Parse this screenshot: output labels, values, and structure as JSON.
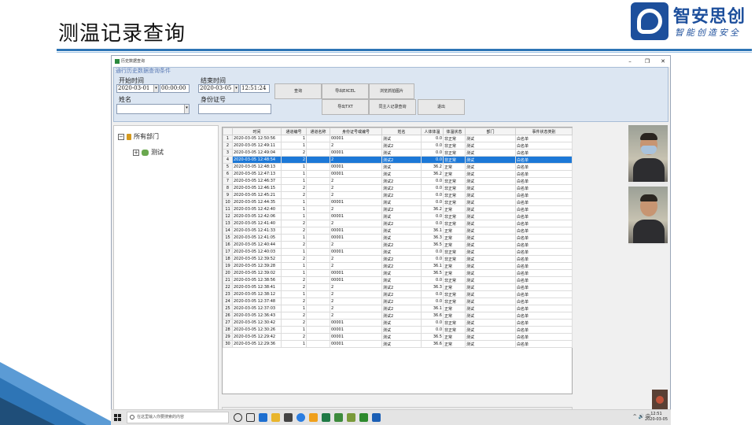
{
  "slide": {
    "title": "测温记录查询",
    "logo_name": "智安思创",
    "logo_slogan": "智能创造安全"
  },
  "window": {
    "title": "历史数据查询",
    "buttons": {
      "minimize": "–",
      "maximize": "❐",
      "close": "✕"
    }
  },
  "query": {
    "panel_title": "通行历史数据查询条件",
    "start_label": "开始时间",
    "start_date": "2020-03-01",
    "start_time": "00:00:00",
    "end_label": "结束时间",
    "end_date": "2020-03-05",
    "end_time": "12:51:24",
    "name_label": "姓名",
    "name_value": "",
    "id_label": "身份证号",
    "id_value": "",
    "buttons": {
      "search": "查询",
      "export_excel": "导出EXCEL",
      "export_txt": "导出TXT",
      "browse_photo": "浏览抓拍图片",
      "same_person": "同主人记录查询",
      "exit": "退出"
    }
  },
  "tree": {
    "root": "所有部门",
    "child": "测试"
  },
  "grid": {
    "columns": [
      "",
      "时间",
      "通道编号",
      "通道名称",
      "身份证号或编号",
      "姓名",
      "人体体温",
      "体温状态",
      "部门",
      "事件状态类别"
    ],
    "selected_row": 4,
    "rows": [
      [
        "1",
        "2020-03-05 12:50:56",
        "1",
        "",
        "00001",
        "测试",
        "0.0",
        "非正常",
        "测试",
        "白名单"
      ],
      [
        "2",
        "2020-03-05 12:49:11",
        "1",
        "",
        "2",
        "测试2",
        "0.0",
        "非正常",
        "测试",
        "白名单"
      ],
      [
        "3",
        "2020-03-05 12:49:04",
        "2",
        "",
        "00001",
        "测试",
        "0.0",
        "非正常",
        "测试",
        "白名单"
      ],
      [
        "4",
        "2020-03-05 12:48:54",
        "2",
        "",
        "2",
        "测试2",
        "0.0",
        "非正常",
        "测试",
        "白名单"
      ],
      [
        "5",
        "2020-03-05 12:48:13",
        "1",
        "",
        "00001",
        "测试",
        "36.2",
        "正常",
        "测试",
        "白名单"
      ],
      [
        "6",
        "2020-03-05 12:47:13",
        "1",
        "",
        "00001",
        "测试",
        "36.2",
        "正常",
        "测试",
        "白名单"
      ],
      [
        "7",
        "2020-03-05 12:46:37",
        "1",
        "",
        "2",
        "测试2",
        "0.0",
        "非正常",
        "测试",
        "白名单"
      ],
      [
        "8",
        "2020-03-05 12:46:15",
        "2",
        "",
        "2",
        "测试2",
        "0.0",
        "非正常",
        "测试",
        "白名单"
      ],
      [
        "9",
        "2020-03-05 12:45:21",
        "2",
        "",
        "2",
        "测试2",
        "0.0",
        "非正常",
        "测试",
        "白名单"
      ],
      [
        "10",
        "2020-03-05 12:44:35",
        "1",
        "",
        "00001",
        "测试",
        "0.0",
        "非正常",
        "测试",
        "白名单"
      ],
      [
        "11",
        "2020-03-05 12:42:40",
        "1",
        "",
        "2",
        "测试2",
        "36.2",
        "正常",
        "测试",
        "白名单"
      ],
      [
        "12",
        "2020-03-05 12:42:06",
        "1",
        "",
        "00001",
        "测试",
        "0.0",
        "非正常",
        "测试",
        "白名单"
      ],
      [
        "13",
        "2020-03-05 12:41:40",
        "2",
        "",
        "2",
        "测试2",
        "0.0",
        "非正常",
        "测试",
        "白名单"
      ],
      [
        "14",
        "2020-03-05 12:41:33",
        "2",
        "",
        "00001",
        "测试",
        "36.1",
        "正常",
        "测试",
        "白名单"
      ],
      [
        "15",
        "2020-03-05 12:41:05",
        "1",
        "",
        "00001",
        "测试",
        "36.3",
        "正常",
        "测试",
        "白名单"
      ],
      [
        "16",
        "2020-03-05 12:40:44",
        "2",
        "",
        "2",
        "测试2",
        "36.5",
        "正常",
        "测试",
        "白名单"
      ],
      [
        "17",
        "2020-03-05 12:40:03",
        "1",
        "",
        "00001",
        "测试",
        "0.0",
        "非正常",
        "测试",
        "白名单"
      ],
      [
        "18",
        "2020-03-05 12:39:52",
        "2",
        "",
        "2",
        "测试2",
        "0.0",
        "非正常",
        "测试",
        "白名单"
      ],
      [
        "19",
        "2020-03-05 12:39:28",
        "1",
        "",
        "2",
        "测试2",
        "36.1",
        "正常",
        "测试",
        "白名单"
      ],
      [
        "20",
        "2020-03-05 12:39:02",
        "1",
        "",
        "00001",
        "测试",
        "36.5",
        "正常",
        "测试",
        "白名单"
      ],
      [
        "21",
        "2020-03-05 12:38:56",
        "2",
        "",
        "00001",
        "测试",
        "0.0",
        "非正常",
        "测试",
        "白名单"
      ],
      [
        "22",
        "2020-03-05 12:38:41",
        "2",
        "",
        "2",
        "测试2",
        "36.3",
        "正常",
        "测试",
        "白名单"
      ],
      [
        "23",
        "2020-03-05 12:38:12",
        "1",
        "",
        "2",
        "测试2",
        "0.0",
        "非正常",
        "测试",
        "白名单"
      ],
      [
        "24",
        "2020-03-05 12:37:48",
        "2",
        "",
        "2",
        "测试2",
        "0.0",
        "非正常",
        "测试",
        "白名单"
      ],
      [
        "25",
        "2020-03-05 12:37:03",
        "1",
        "",
        "2",
        "测试2",
        "36.1",
        "正常",
        "测试",
        "白名单"
      ],
      [
        "26",
        "2020-03-05 12:36:43",
        "2",
        "",
        "2",
        "测试2",
        "36.6",
        "正常",
        "测试",
        "白名单"
      ],
      [
        "27",
        "2020-03-05 12:30:42",
        "2",
        "",
        "00001",
        "测试",
        "0.0",
        "非正常",
        "测试",
        "白名单"
      ],
      [
        "28",
        "2020-03-05 12:30:26",
        "1",
        "",
        "00001",
        "测试",
        "0.0",
        "非正常",
        "测试",
        "白名单"
      ],
      [
        "29",
        "2020-03-05 12:29:42",
        "2",
        "",
        "00001",
        "测试",
        "36.5",
        "正常",
        "测试",
        "白名单"
      ],
      [
        "30",
        "2020-03-05 12:29:36",
        "1",
        "",
        "00001",
        "测试",
        "36.6",
        "正常",
        "测试",
        "白名单"
      ]
    ]
  },
  "taskbar": {
    "search_placeholder": "在这里输入你要搜索的内容",
    "tray": "^ 🔊 中",
    "time": "12:51",
    "date": "2020-03-05"
  },
  "colors": {
    "accent": "#2e75b6",
    "brand": "#1d4f9c",
    "selected": "#1c78d7"
  }
}
